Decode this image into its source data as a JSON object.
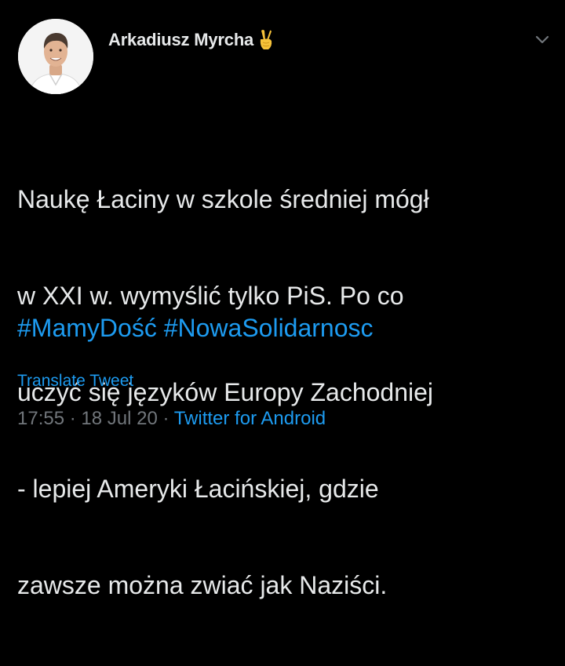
{
  "author": {
    "display_name": "Arkadiusz Myrcha",
    "name_emoji": "✌️",
    "avatar_icon": "profile-photo"
  },
  "tweet": {
    "lines": [
      "Naukę Łaciny w szkole średniej mógł",
      "w XXI w. wymyślić tylko PiS. Po co",
      "uczyć się języków Europy Zachodniej",
      "- lepiej Ameryki Łacińskiej, gdzie",
      "zawsze można zwiać jak Naziści."
    ],
    "hashtags": [
      "#MamyDość",
      "#NowaSolidarnosc"
    ]
  },
  "actions": {
    "translate_label": "Translate Tweet",
    "more_icon": "chevron-down-icon"
  },
  "meta": {
    "time": "17:55",
    "separator": " · ",
    "date": "18 Jul 20",
    "source": "Twitter for Android"
  },
  "colors": {
    "background": "#000000",
    "text": "#e7e9ea",
    "link": "#1d9bf0",
    "muted": "#71767b"
  }
}
